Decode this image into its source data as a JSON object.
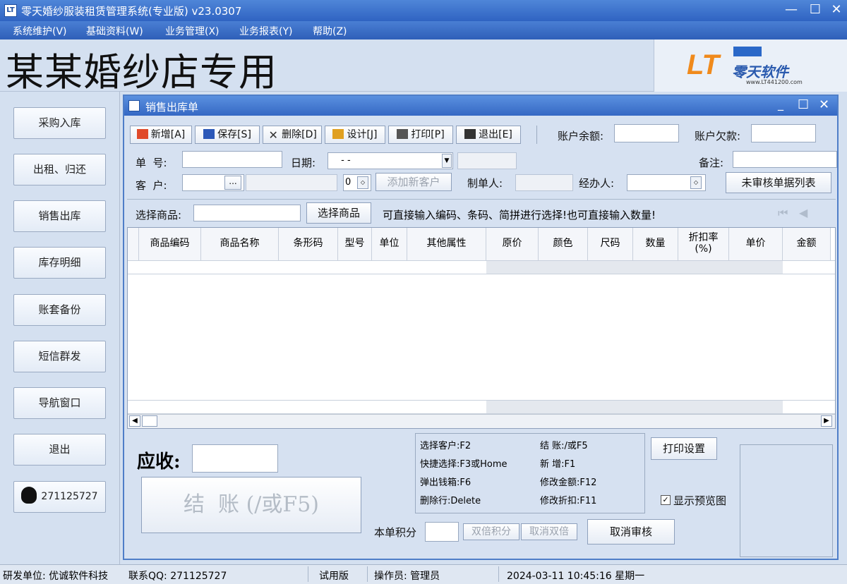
{
  "app": {
    "title": "零天婚纱服装租赁管理系统(专业版)  v23.0307",
    "icon_label": "LT"
  },
  "menu": [
    "系统维护(V)",
    "基础资料(W)",
    "业务管理(X)",
    "业务报表(Y)",
    "帮助(Z)"
  ],
  "banner": {
    "shop_name": "某某婚纱店专用",
    "logo_brand": "零天软件",
    "logo_url": "www.LT441200.com",
    "logo_mark": "LT"
  },
  "sidebar": [
    "采购入库",
    "出租、归还",
    "销售出库",
    "库存明细",
    "账套备份",
    "短信群发",
    "导航窗口",
    "退出"
  ],
  "qq": {
    "number": "271125727"
  },
  "form": {
    "title": "销售出库单",
    "toolbar": [
      "新增[A]",
      "保存[S]",
      "删除[D]",
      "设计[J]",
      "打印[P]",
      "退出[E]"
    ],
    "account_balance_label": "账户余额:",
    "account_debt_label": "账户欠款:",
    "order_no_label": "单  号:",
    "date_label": "日期:",
    "date_value": " - -",
    "remark_label": "备注:",
    "customer_label": "客  户:",
    "customer_btn": "...",
    "spin_value": "0",
    "add_customer": "添加新客户",
    "maker_label": "制单人:",
    "handler_label": "经办人:",
    "unaudited_list": "未审核单据列表",
    "select_goods_label": "选择商品:",
    "select_goods_btn": "选择商品",
    "hint": "可直接输入编码、条码、简拼进行选择!也可直接输入数量!",
    "columns": [
      "商品编码",
      "商品名称",
      "条形码",
      "型号",
      "单位",
      "其他属性",
      "原价",
      "颜色",
      "尺码",
      "数量",
      "折扣率\n(%)",
      "单价",
      "金额"
    ],
    "receivable_label": "应收:",
    "checkout": "结  账 (/或F5)",
    "shortcuts": [
      [
        "选择客户:F2",
        "结 账:/或F5"
      ],
      [
        "快捷选择:F3或Home",
        "新 增:F1"
      ],
      [
        "弹出钱箱:F6",
        "修改金额:F12"
      ],
      [
        "删除行:Delete",
        "修改折扣:F11"
      ]
    ],
    "points_label": "本单积分",
    "double_points": "双倍积分",
    "cancel_double": "取消双倍",
    "print_settings": "打印设置",
    "show_preview": "显示预览图",
    "show_preview_checked": true,
    "cancel_audit": "取消审核"
  },
  "status": {
    "dev": "研发单位: 优诚软件科技",
    "contact": "联系QQ: 271125727",
    "trial": "试用版",
    "operator": "操作员: 管理员",
    "datetime": "2024-03-11 10:45:16 星期一"
  }
}
